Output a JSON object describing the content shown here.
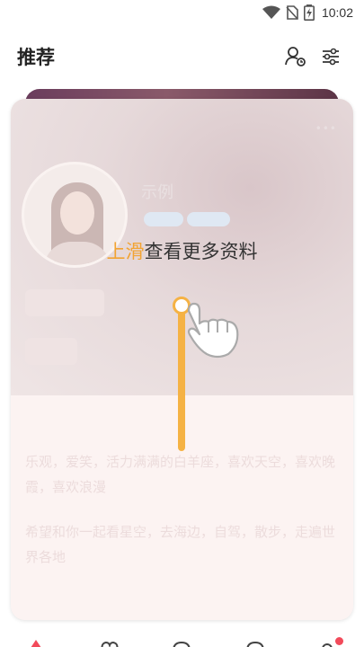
{
  "status_bar": {
    "time": "10:02",
    "icons": [
      "wifi-icon",
      "no-sim-icon",
      "battery-icon"
    ]
  },
  "header": {
    "title": "推荐",
    "buttons": [
      "person-settings-icon",
      "filter-sliders-icon"
    ]
  },
  "card": {
    "username": "示例",
    "tags": [
      "",
      ""
    ],
    "info_pills": [
      "",
      "",
      "",
      ""
    ],
    "section_title": "",
    "bio_lines": [
      "乐观，爱笑，活力满满的白羊座，喜欢天空，喜欢晚霞，喜欢浪漫",
      "希望和你一起看星空，去海边，自驾，散步，走遍世界各地"
    ]
  },
  "overlay": {
    "hint_accent": "上滑",
    "hint_rest": "查看更多资料"
  },
  "colors": {
    "accent": "#f2a332",
    "swipe_track": "#f5b244",
    "notification_dot": "#f24a5a"
  },
  "bottom_nav": {
    "items": [
      "home-icon",
      "heart-icon",
      "chat-icon",
      "message-icon",
      "profile-icon"
    ]
  }
}
